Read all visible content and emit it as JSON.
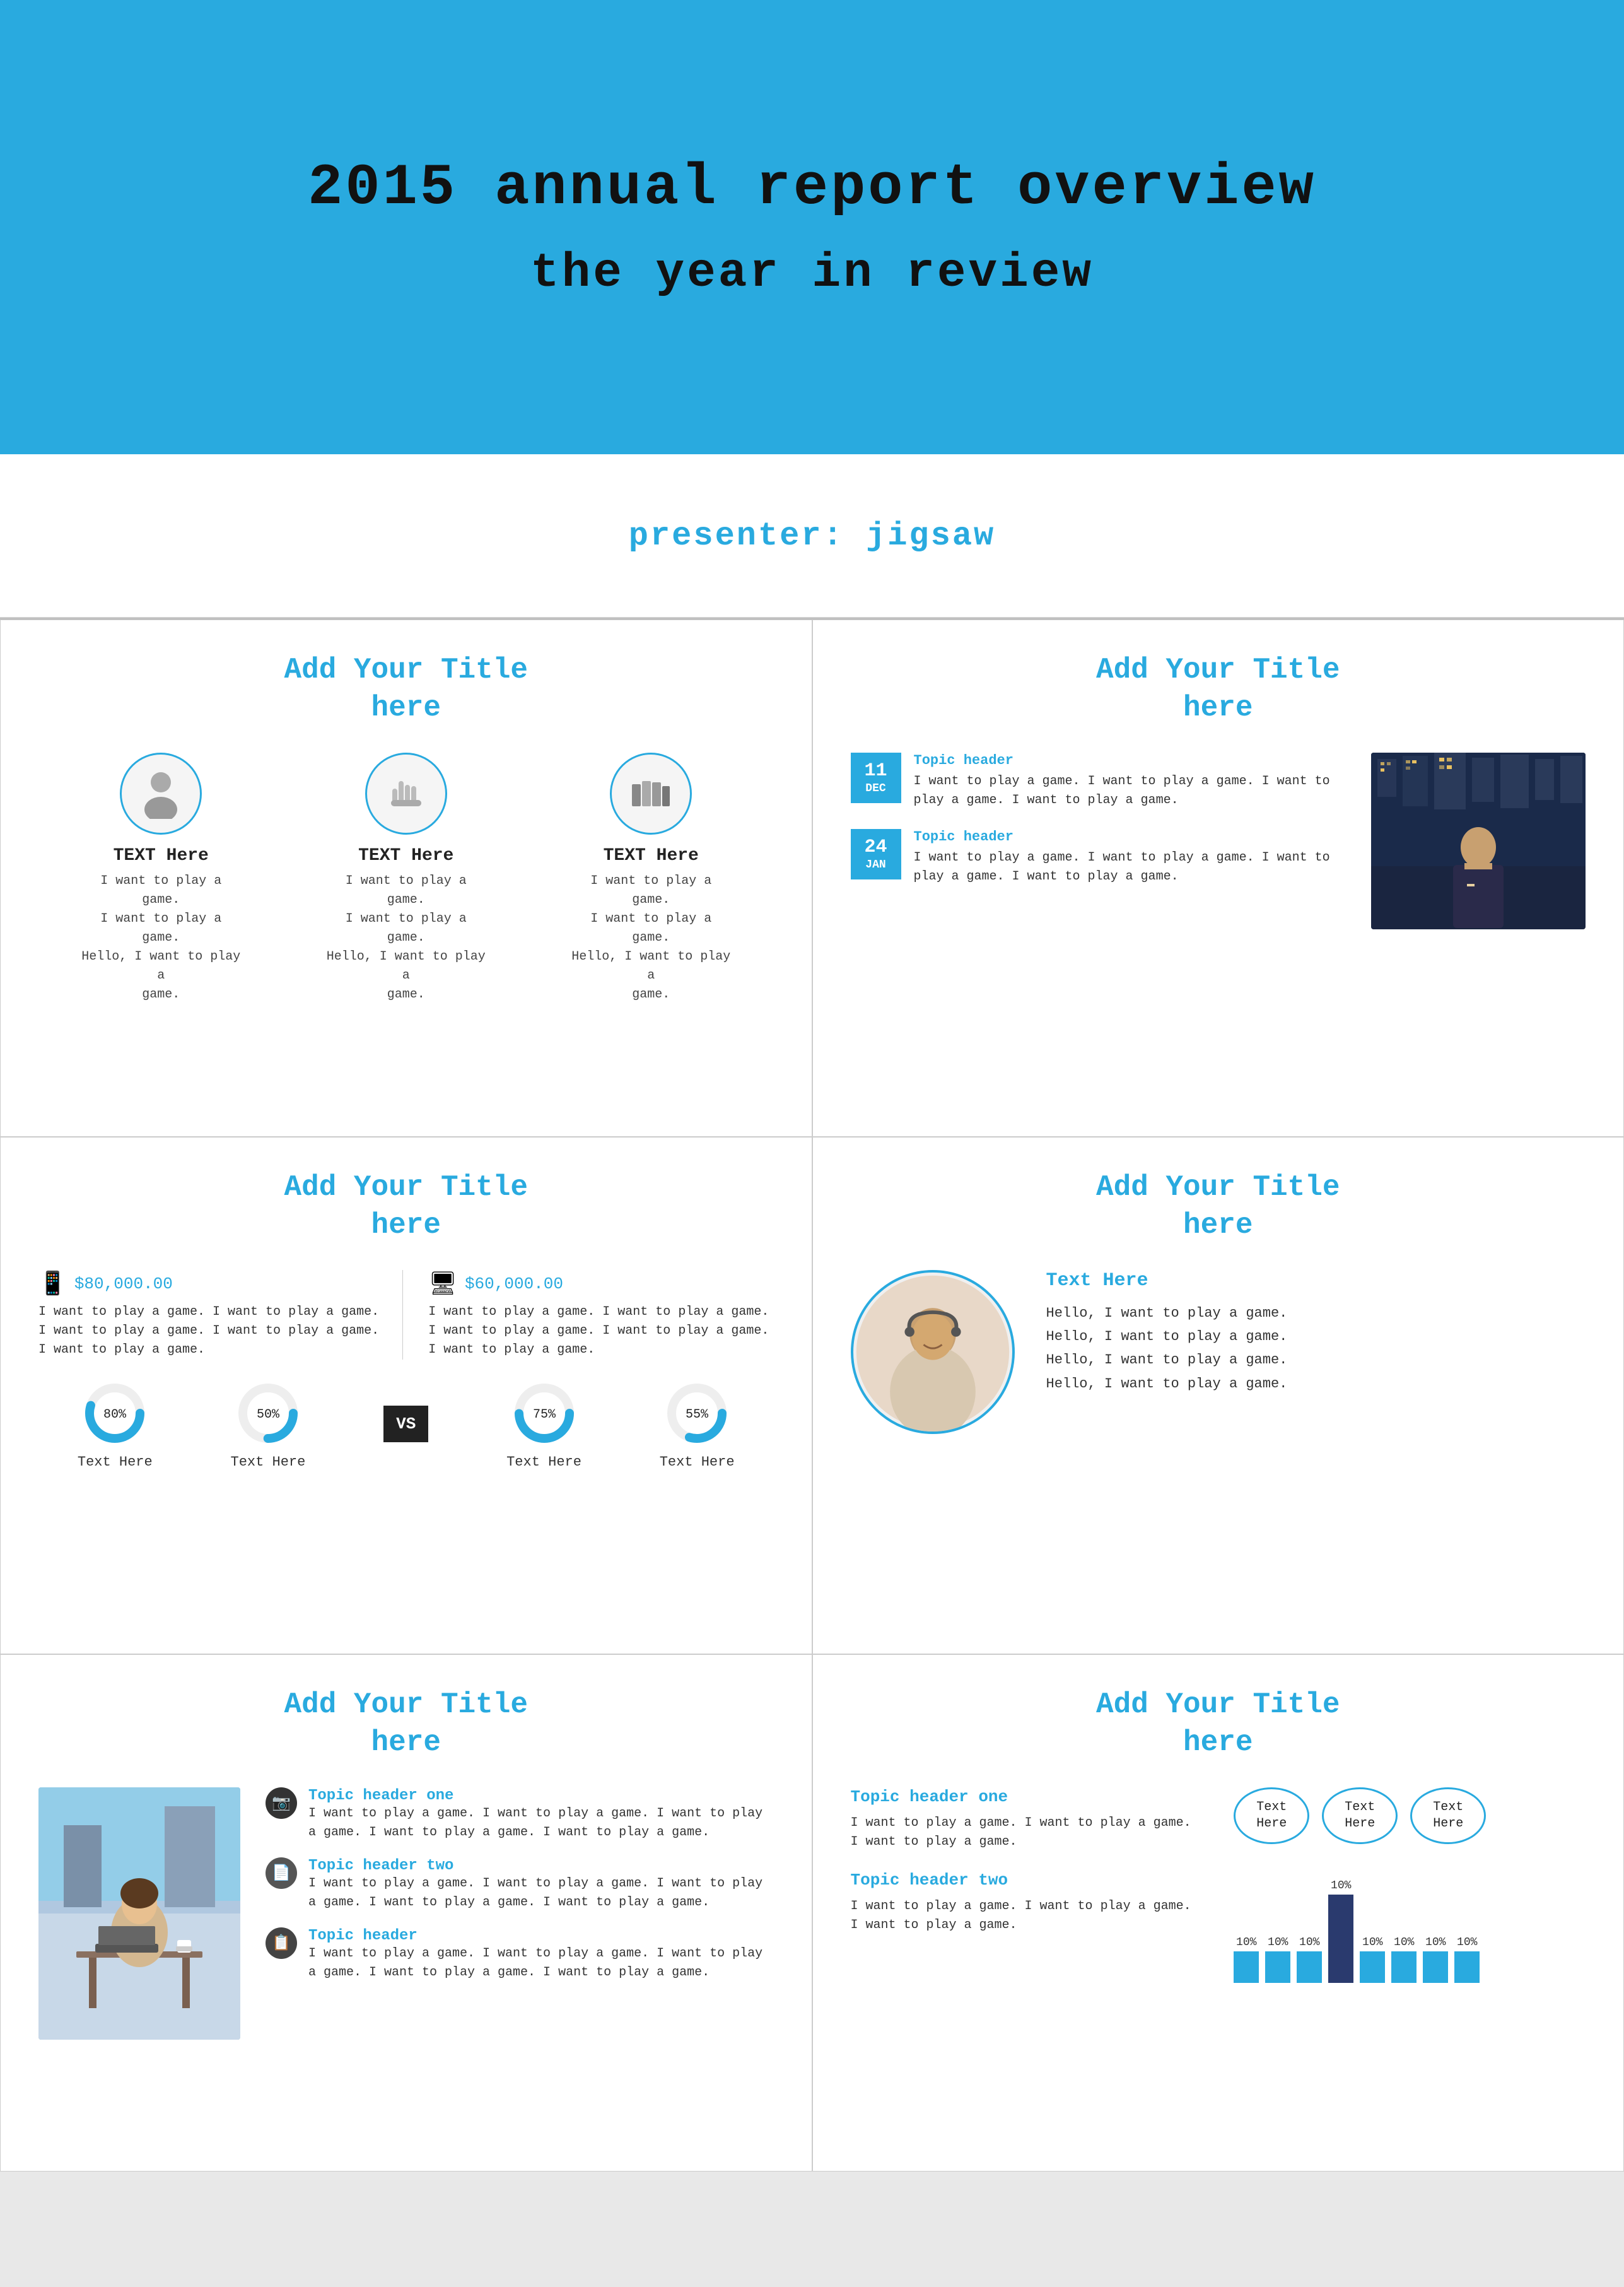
{
  "hero": {
    "title": "2015 annual report overview",
    "subtitle": "the year in review"
  },
  "presenter": {
    "label": "presenter:  jigsaw"
  },
  "slide1": {
    "title": "Add Your Title\nhere",
    "items": [
      {
        "icon": "👤",
        "label": "TEXT Here",
        "text": "I want to play a game.\nI want to play a game.\nHello, I want to play a\ngame."
      },
      {
        "icon": "✋",
        "label": "TEXT Here",
        "text": "I want to play a game.\nI want to play a game.\nHello, I want to play a\ngame."
      },
      {
        "icon": "📚",
        "label": "TEXT Here",
        "text": "I want to play a game.\nI want to play a game.\nHello, I want to play a\ngame."
      }
    ]
  },
  "slide2": {
    "title": "Add Your Title\nhere",
    "events": [
      {
        "day": "11",
        "month": "DEC",
        "header": "Topic header",
        "text": "I want to play a game. I want to play a game. I want to play a game. I want to play a game."
      },
      {
        "day": "24",
        "month": "JAN",
        "header": "Topic header",
        "text": "I want to play a game. I want to play a game. I want to play a game. I want to play a game."
      }
    ]
  },
  "slide3": {
    "title": "Add Your Title\nhere",
    "left": {
      "device": "📱",
      "amount": "$80,000.00",
      "desc": "I want to play a game. I want to play a game. I want to play a game. I want to play a game. I want to play a game."
    },
    "right": {
      "device": "🖥",
      "amount": "$60,000.00",
      "desc": "I want to play a game. I want to play a game. I want to play a game. I want to play a game. I want to play a game."
    },
    "circles": [
      {
        "pct": 80,
        "label": "Text Here"
      },
      {
        "pct": 50,
        "label": "Text Here"
      },
      {
        "pct": 75,
        "label": "Text Here"
      },
      {
        "pct": 55,
        "label": "Text Here"
      }
    ],
    "vs_label": "VS"
  },
  "slide4": {
    "title": "Add Your Title\nhere",
    "text_header": "Text Here",
    "text_body": "Hello, I want to play a game.\nHello, I want to play a game.\nHello, I want to play a game.\nHello, I want to play a game."
  },
  "slide5": {
    "title": "Add Your Title\nhere",
    "topics": [
      {
        "label": "Topic header one",
        "text": "I want to play a game. I want to play a game. I want to play a game. I want to play a game. I want to play a game."
      },
      {
        "label": "Topic header two",
        "text": "I want to play a game. I want to play a game. I want to play a game. I want to play a game. I want to play a game."
      },
      {
        "label": "Topic header",
        "text": "I want to play a game. I want to play a game. I want to play a game. I want to play a game. I want to play a game."
      }
    ]
  },
  "slide6": {
    "title": "Add Your Title\nhere",
    "topic1_header": "Topic header one",
    "topic1_text": "I want to play a game. I want to play a game. I want to play a game.",
    "topic2_header": "Topic header two",
    "topic2_text": "I want to play a game. I want to play a game. I want to play a game.",
    "bubbles": [
      "Text\nHere",
      "Text\nHere",
      "Text\nHere"
    ],
    "bars": [
      {
        "pct": 10,
        "height": 40,
        "dark": false
      },
      {
        "pct": 10,
        "height": 40,
        "dark": false
      },
      {
        "pct": 10,
        "height": 40,
        "dark": false
      },
      {
        "pct": 10,
        "height": 100,
        "dark": true
      },
      {
        "pct": 10,
        "height": 40,
        "dark": false
      },
      {
        "pct": 10,
        "height": 40,
        "dark": false
      },
      {
        "pct": 10,
        "height": 40,
        "dark": false
      },
      {
        "pct": 10,
        "height": 40,
        "dark": false
      }
    ]
  },
  "detection": {
    "text559": "559 Text Here",
    "text759": "759 Text Here"
  }
}
